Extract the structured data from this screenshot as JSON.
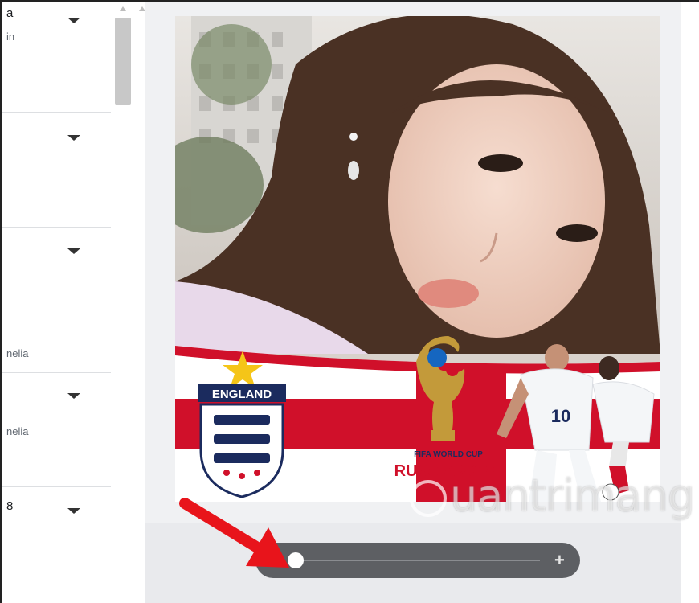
{
  "list": {
    "items": [
      {
        "line1": "a",
        "line2": "in"
      },
      {
        "line1": "",
        "line2": ""
      },
      {
        "line1": "",
        "line2": "nelia"
      },
      {
        "line1": "",
        "line2": "nelia"
      },
      {
        "line1": "8",
        "line2": ""
      }
    ]
  },
  "frame": {
    "team": "ENGLAND",
    "cup": "FIFA WORLD CUP",
    "event": "RUSSIA 2018",
    "player_number": "10"
  },
  "slider": {
    "plus_label": "+",
    "zoom_value": 0
  },
  "watermark": {
    "text": "uantrimang"
  },
  "colors": {
    "england_red": "#d0102a",
    "slider_bg": "#5d5f63",
    "annotation_arrow": "#e8141b"
  },
  "icons": {
    "caret": "caret-down-icon",
    "plus": "plus-icon",
    "arrow": "red-arrow-annotation"
  }
}
